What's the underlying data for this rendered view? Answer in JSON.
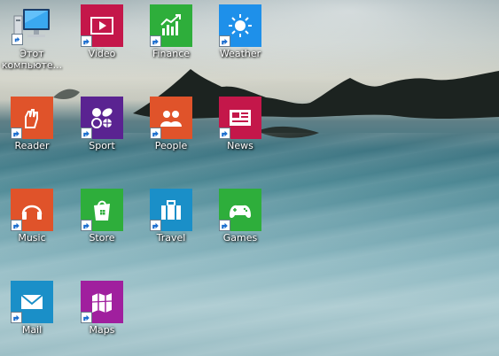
{
  "desktop": {
    "icons": [
      {
        "label": "Этот компьюте...",
        "icon": "computer-icon",
        "color": ""
      },
      {
        "label": "Video",
        "icon": "video-icon",
        "color": "#c4174a"
      },
      {
        "label": "Finance",
        "icon": "finance-chart-icon",
        "color": "#2eae3b"
      },
      {
        "label": "Weather",
        "icon": "sun-icon",
        "color": "#1e90ea"
      },
      {
        "label": "Reader",
        "icon": "reader-hand-icon",
        "color": "#e0532a"
      },
      {
        "label": "Sport",
        "icon": "sport-balls-icon",
        "color": "#5a2391"
      },
      {
        "label": "People",
        "icon": "people-icon",
        "color": "#e0532a"
      },
      {
        "label": "News",
        "icon": "news-icon",
        "color": "#c4174a"
      },
      {
        "label": "Music",
        "icon": "headphones-icon",
        "color": "#e0532a"
      },
      {
        "label": "Store",
        "icon": "shopping-bag-icon",
        "color": "#2eae3b"
      },
      {
        "label": "Travel",
        "icon": "suitcase-icon",
        "color": "#1a8fc8"
      },
      {
        "label": "Games",
        "icon": "game-controller-icon",
        "color": "#2eae3b"
      },
      {
        "label": "Mail",
        "icon": "envelope-icon",
        "color": "#1a8fc8"
      },
      {
        "label": "Maps",
        "icon": "map-icon",
        "color": "#a01f9e"
      }
    ]
  }
}
